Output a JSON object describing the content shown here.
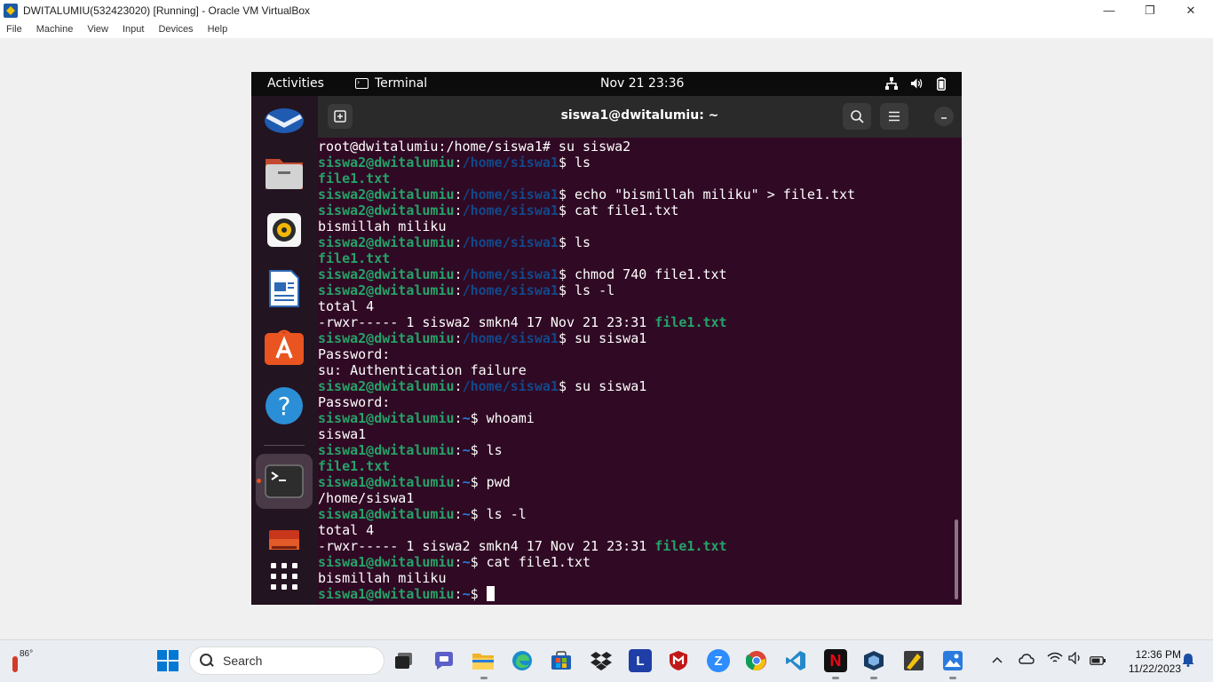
{
  "host": {
    "window_title": "DWITALUMIU(532423020) [Running] - Oracle VM VirtualBox",
    "controls": {
      "minimize": "—",
      "restore": "❐",
      "close": "✕"
    },
    "menu": [
      "File",
      "Machine",
      "View",
      "Input",
      "Devices",
      "Help"
    ]
  },
  "guest": {
    "topbar": {
      "activities": "Activities",
      "app_name": "Terminal",
      "clock": "Nov 21  23:36"
    },
    "terminal": {
      "title": "siswa1@dwitalumiu: ~",
      "lines": [
        {
          "plain": "root@dwitalumiu:/home/siswa1# su siswa2"
        },
        {
          "user": "siswa2@dwitalumiu",
          "sep": ":",
          "path": "/home/siswa1",
          "cmd": "$ ls"
        },
        {
          "file": "file1.txt"
        },
        {
          "user": "siswa2@dwitalumiu",
          "sep": ":",
          "path": "/home/siswa1",
          "cmd": "$ echo \"bismillah miliku\" > file1.txt"
        },
        {
          "user": "siswa2@dwitalumiu",
          "sep": ":",
          "path": "/home/siswa1",
          "cmd": "$ cat file1.txt"
        },
        {
          "plain": "bismillah miliku"
        },
        {
          "user": "siswa2@dwitalumiu",
          "sep": ":",
          "path": "/home/siswa1",
          "cmd": "$ ls"
        },
        {
          "file": "file1.txt"
        },
        {
          "user": "siswa2@dwitalumiu",
          "sep": ":",
          "path": "/home/siswa1",
          "cmd": "$ chmod 740 file1.txt"
        },
        {
          "user": "siswa2@dwitalumiu",
          "sep": ":",
          "path": "/home/siswa1",
          "cmd": "$ ls -l"
        },
        {
          "plain": "total 4"
        },
        {
          "plain": "-rwxr----- 1 siswa2 smkn4 17 Nov 21 23:31 ",
          "file": "file1.txt"
        },
        {
          "user": "siswa2@dwitalumiu",
          "sep": ":",
          "path": "/home/siswa1",
          "cmd": "$ su siswa1"
        },
        {
          "plain": "Password:"
        },
        {
          "plain": "su: Authentication failure"
        },
        {
          "user": "siswa2@dwitalumiu",
          "sep": ":",
          "path": "/home/siswa1",
          "cmd": "$ su siswa1"
        },
        {
          "plain": "Password:"
        },
        {
          "user": "siswa1@dwitalumiu",
          "sep": ":",
          "tilde": "~",
          "cmd": "$ whoami"
        },
        {
          "plain": "siswa1"
        },
        {
          "user": "siswa1@dwitalumiu",
          "sep": ":",
          "tilde": "~",
          "cmd": "$ ls"
        },
        {
          "file": "file1.txt"
        },
        {
          "user": "siswa1@dwitalumiu",
          "sep": ":",
          "tilde": "~",
          "cmd": "$ pwd"
        },
        {
          "plain": "/home/siswa1"
        },
        {
          "user": "siswa1@dwitalumiu",
          "sep": ":",
          "tilde": "~",
          "cmd": "$ ls -l"
        },
        {
          "plain": "total 4"
        },
        {
          "plain": "-rwxr----- 1 siswa2 smkn4 17 Nov 21 23:31 ",
          "file": "file1.txt"
        },
        {
          "user": "siswa1@dwitalumiu",
          "sep": ":",
          "tilde": "~",
          "cmd": "$ cat file1.txt"
        },
        {
          "plain": "bismillah miliku"
        },
        {
          "user": "siswa1@dwitalumiu",
          "sep": ":",
          "tilde": "~",
          "cmd": "$ ",
          "cursor": true
        }
      ]
    }
  },
  "taskbar": {
    "weather_temp": "86°",
    "search_label": "Search",
    "clock_time": "12:36 PM",
    "clock_date": "11/22/2023"
  },
  "colors": {
    "terminal_bg": "#300a24",
    "prompt_user": "#26a269",
    "prompt_path": "#12488b",
    "ubuntu_orange": "#e95420"
  }
}
